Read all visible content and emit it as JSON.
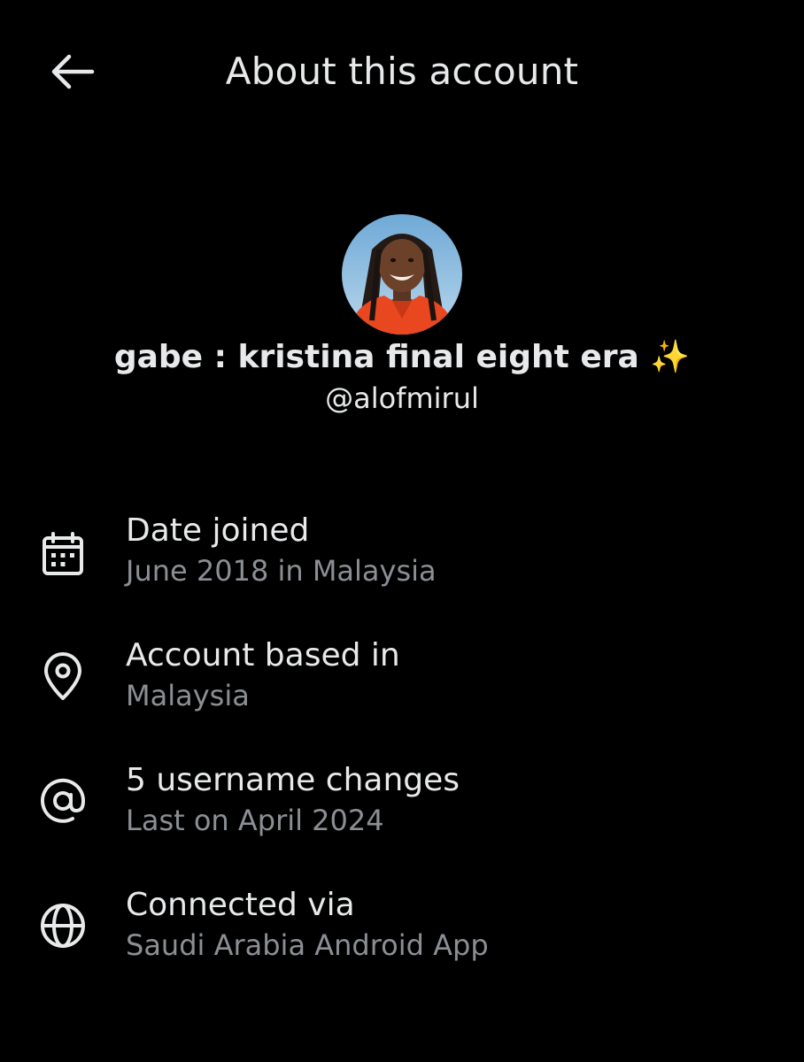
{
  "header": {
    "title": "About this account",
    "back_icon": "arrow-left-icon"
  },
  "profile": {
    "display_name": "gabe : kristina final eight era ✨",
    "handle": "@alofmirul"
  },
  "info": [
    {
      "icon": "calendar-icon",
      "label": "Date joined",
      "value": "June 2018 in Malaysia"
    },
    {
      "icon": "location-pin-icon",
      "label": "Account based in",
      "value": "Malaysia"
    },
    {
      "icon": "at-sign-icon",
      "label": "5 username changes",
      "value": "Last on April 2024"
    },
    {
      "icon": "globe-icon",
      "label": "Connected via",
      "value": "Saudi Arabia Android App"
    }
  ],
  "colors": {
    "background": "#000000",
    "primary_text": "#e7e9ea",
    "secondary_text": "#8b8f94"
  }
}
